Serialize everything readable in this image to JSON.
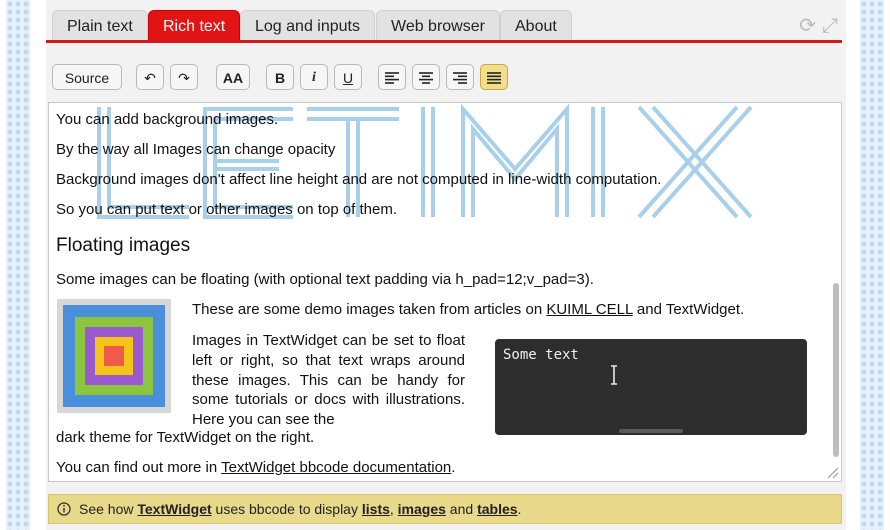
{
  "tabs": [
    "Plain text",
    "Rich text",
    "Log and inputs",
    "Web browser",
    "About"
  ],
  "toolbar": {
    "source": "Source",
    "undo": "↶",
    "redo": "↷",
    "font_size": "AA",
    "bold": "B",
    "italic": "i",
    "underline": "U"
  },
  "watermark": "LETIMIX",
  "content": {
    "l1": "You can add background images.",
    "l2": "By the way all Images can change opacity",
    "l3": "Background images don't affect line height and are not computed in line-width computation.",
    "l4": "So you can put text or other images on top of them.",
    "heading": "Floating images",
    "l5": "Some images can be floating (with optional text padding via h_pad=12;v_pad=3).",
    "demo_a": "These are some demo images taken from articles on ",
    "demo_link": "KUIML CELL",
    "demo_b": " and TextWidget.",
    "para": "Images in TextWidget can be set to float left or right, so that text wraps around these images. This can be handy for some tutorials or docs with illustrations. Here you can see the",
    "para_end": "dark theme for TextWidget on the right.",
    "more_a": "You can find out more in ",
    "more_link": "TextWidget bbcode documentation",
    "more_b": "."
  },
  "dark_box": {
    "text": "Some text"
  },
  "info_bar": {
    "prefix": "See how ",
    "w1": "TextWidget",
    "mid": " uses bbcode to display ",
    "w2": "lists",
    "sep1": ", ",
    "w3": "images",
    "sep2": " and ",
    "w4": "tables",
    "suffix": "."
  },
  "colors": {
    "accent": "#d41a1a",
    "watermark": "#a9d0ea",
    "squares": [
      "#4a8fdc",
      "#8cc63f",
      "#9b59d0",
      "#f5c518",
      "#f05a4a"
    ]
  }
}
